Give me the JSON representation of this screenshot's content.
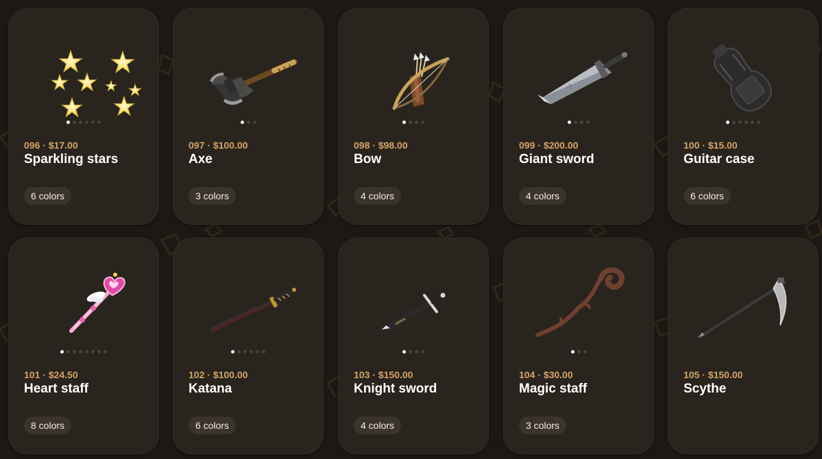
{
  "products": [
    {
      "number": "096",
      "price": "$17.00",
      "name": "Sparkling stars",
      "colors": "6 colors",
      "variant_count": 6,
      "selected_variant": 1,
      "icon": "sparkling-stars-icon"
    },
    {
      "number": "097",
      "price": "$100.00",
      "name": "Axe",
      "colors": "3 colors",
      "variant_count": 3,
      "selected_variant": 1,
      "icon": "axe-icon"
    },
    {
      "number": "098",
      "price": "$98.00",
      "name": "Bow",
      "colors": "4 colors",
      "variant_count": 4,
      "selected_variant": 1,
      "icon": "bow-icon"
    },
    {
      "number": "099",
      "price": "$200.00",
      "name": "Giant sword",
      "colors": "4 colors",
      "variant_count": 4,
      "selected_variant": 1,
      "icon": "giant-sword-icon"
    },
    {
      "number": "100",
      "price": "$15.00",
      "name": "Guitar case",
      "colors": "6 colors",
      "variant_count": 6,
      "selected_variant": 1,
      "icon": "guitar-case-icon"
    },
    {
      "number": "101",
      "price": "$24.50",
      "name": "Heart staff",
      "colors": "8 colors",
      "variant_count": 8,
      "selected_variant": 1,
      "icon": "heart-staff-icon"
    },
    {
      "number": "102",
      "price": "$100.00",
      "name": "Katana",
      "colors": "6 colors",
      "variant_count": 6,
      "selected_variant": 1,
      "icon": "katana-icon"
    },
    {
      "number": "103",
      "price": "$150.00",
      "name": "Knight sword",
      "colors": "4 colors",
      "variant_count": 4,
      "selected_variant": 1,
      "icon": "knight-sword-icon"
    },
    {
      "number": "104",
      "price": "$30.00",
      "name": "Magic staff",
      "colors": "3 colors",
      "variant_count": 3,
      "selected_variant": 1,
      "icon": "magic-staff-icon"
    },
    {
      "number": "105",
      "price": "$150.00",
      "name": "Scythe",
      "colors": "",
      "variant_count": 0,
      "selected_variant": 0,
      "icon": "scythe-icon"
    }
  ],
  "meta_separator": " · ",
  "colors": {
    "background": "#1c1915",
    "card": "#2a241e",
    "price_accent": "#d4a46a",
    "badge": "#3b342c"
  }
}
